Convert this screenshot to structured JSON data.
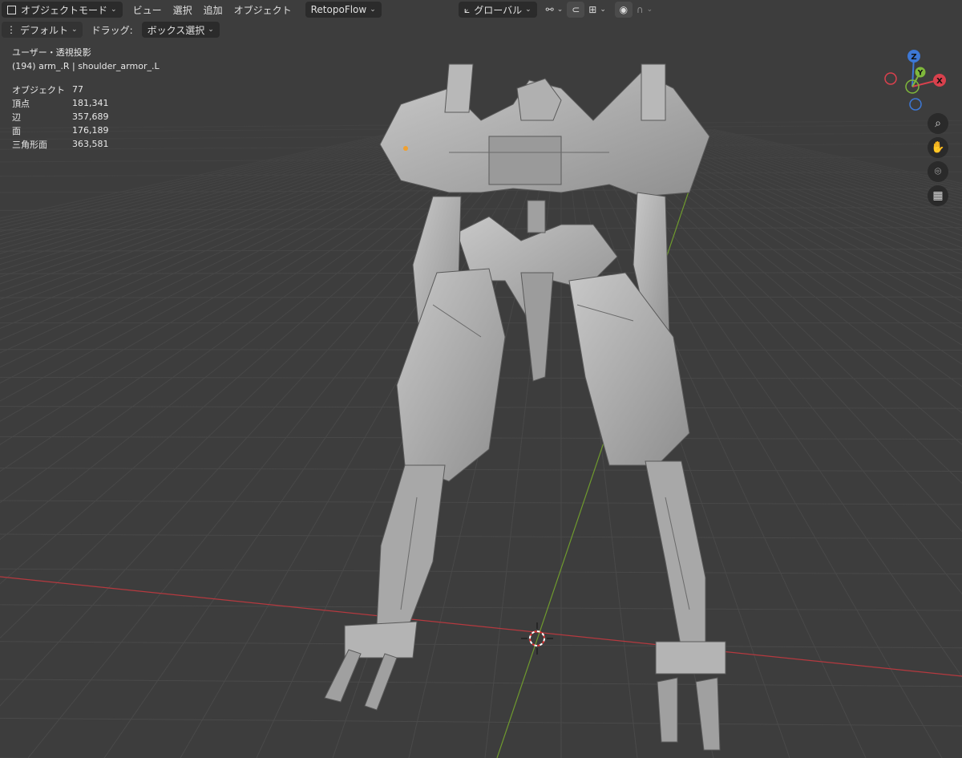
{
  "header": {
    "mode_label": "オブジェクトモード",
    "menus": [
      "ビュー",
      "選択",
      "追加",
      "オブジェクト"
    ],
    "addon_label": "RetopoFlow",
    "orientation_label": "グローバル"
  },
  "toolbar": {
    "pivot_label": "デフォルト",
    "drag_label": "ドラッグ:",
    "drag_value": "ボックス選択"
  },
  "viewport": {
    "view_name": "ユーザー・透視投影",
    "active_object": "(194) arm_.R | shoulder_armor_.L"
  },
  "stats": [
    {
      "label": "オブジェクト",
      "value": "77"
    },
    {
      "label": "頂点",
      "value": "181,341"
    },
    {
      "label": "辺",
      "value": "357,689"
    },
    {
      "label": "面",
      "value": "176,189"
    },
    {
      "label": "三角形面",
      "value": "363,581"
    }
  ],
  "gizmo": {
    "z_label": "Z",
    "y_label": "Y",
    "x_label": "X",
    "x_color": "#d9414d",
    "y_color": "#7fb83b",
    "z_color": "#3d78d6"
  },
  "nav_icons": [
    "zoom-icon",
    "pan-hand-icon",
    "camera-icon",
    "perspective-grid-icon"
  ]
}
